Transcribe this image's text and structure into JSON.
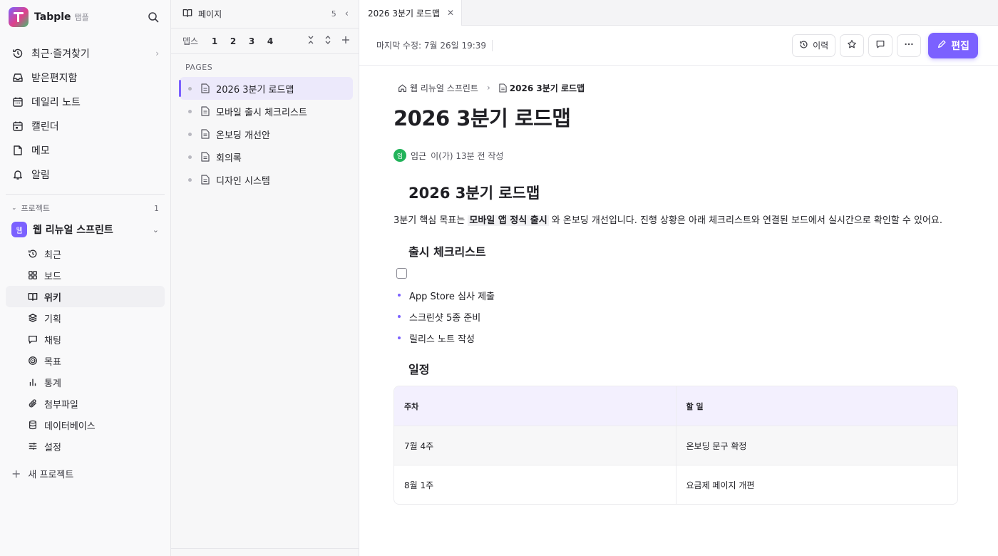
{
  "brand": {
    "name": "Tabple",
    "sub": "탭플"
  },
  "nav": [
    {
      "label": "최근·즐겨찾기",
      "icon": "history-icon"
    },
    {
      "label": "받은편지함",
      "icon": "inbox-icon"
    },
    {
      "label": "데일리 노트",
      "icon": "daily-calendar-icon"
    },
    {
      "label": "캘린더",
      "icon": "calendar-icon"
    },
    {
      "label": "메모",
      "icon": "memo-icon"
    },
    {
      "label": "알림",
      "icon": "bell-icon"
    }
  ],
  "projects": {
    "heading": "프로젝트",
    "count": "1",
    "current": {
      "avatar": "웹",
      "name": "웹 리뉴얼 스프린트"
    },
    "items": [
      {
        "label": "최근",
        "icon": "history-icon"
      },
      {
        "label": "보드",
        "icon": "board-icon"
      },
      {
        "label": "위키",
        "icon": "book-icon",
        "active": true
      },
      {
        "label": "기획",
        "icon": "layers-icon"
      },
      {
        "label": "채팅",
        "icon": "chat-icon"
      },
      {
        "label": "목표",
        "icon": "target-icon"
      },
      {
        "label": "통계",
        "icon": "stats-icon"
      },
      {
        "label": "첨부파일",
        "icon": "paperclip-icon"
      },
      {
        "label": "데이터베이스",
        "icon": "database-icon"
      },
      {
        "label": "설정",
        "icon": "sliders-icon"
      }
    ],
    "new_label": "새 프로젝트"
  },
  "pages_panel": {
    "title": "페이지",
    "count": "5",
    "depth_label": "뎁스",
    "depths": [
      "1",
      "2",
      "3",
      "4"
    ],
    "section_label": "PAGES",
    "pages": [
      "2026 3분기 로드맵",
      "모바일 출시 체크리스트",
      "온보딩 개선안",
      "회의록",
      "디자인 시스템"
    ]
  },
  "tab": {
    "label": "2026 3분기 로드맵"
  },
  "toolbar": {
    "modified": "마지막 수정: 7월 26일 19:39",
    "history_label": "이력",
    "edit_label": "편집"
  },
  "doc": {
    "breadcrumb_parent": "웹 리뉴얼 스프린트",
    "breadcrumb_current": "2026 3분기 로드맵",
    "title": "2026 3분기 로드맵",
    "author_initial": "임",
    "author": "임근",
    "author_meta": "이(가) 13분 전 작성",
    "heading1": "2026 3분기 로드맵",
    "para_before": "3분기 핵심 목표는 ",
    "para_bold": "모바일 앱 정식 출시",
    "para_after": " 와 온보딩 개선입니다. 진행 상황은 아래 체크리스트와 연결된 보드에서 실시간으로 확인할 수 있어요.",
    "checklist_heading": "출시 체크리스트",
    "bullets": [
      "App Store 심사 제출",
      "스크린샷 5종 준비",
      "릴리스 노트 작성"
    ],
    "schedule_heading": "일정",
    "table": {
      "headers": [
        "주차",
        "할 일"
      ],
      "rows": [
        [
          "7월 4주",
          "온보딩 문구 확정"
        ],
        [
          "8월 1주",
          "요금제 페이지 개편"
        ]
      ]
    }
  },
  "colors": {
    "accent": "#7b61ff",
    "avatar_green": "#22b35a"
  }
}
